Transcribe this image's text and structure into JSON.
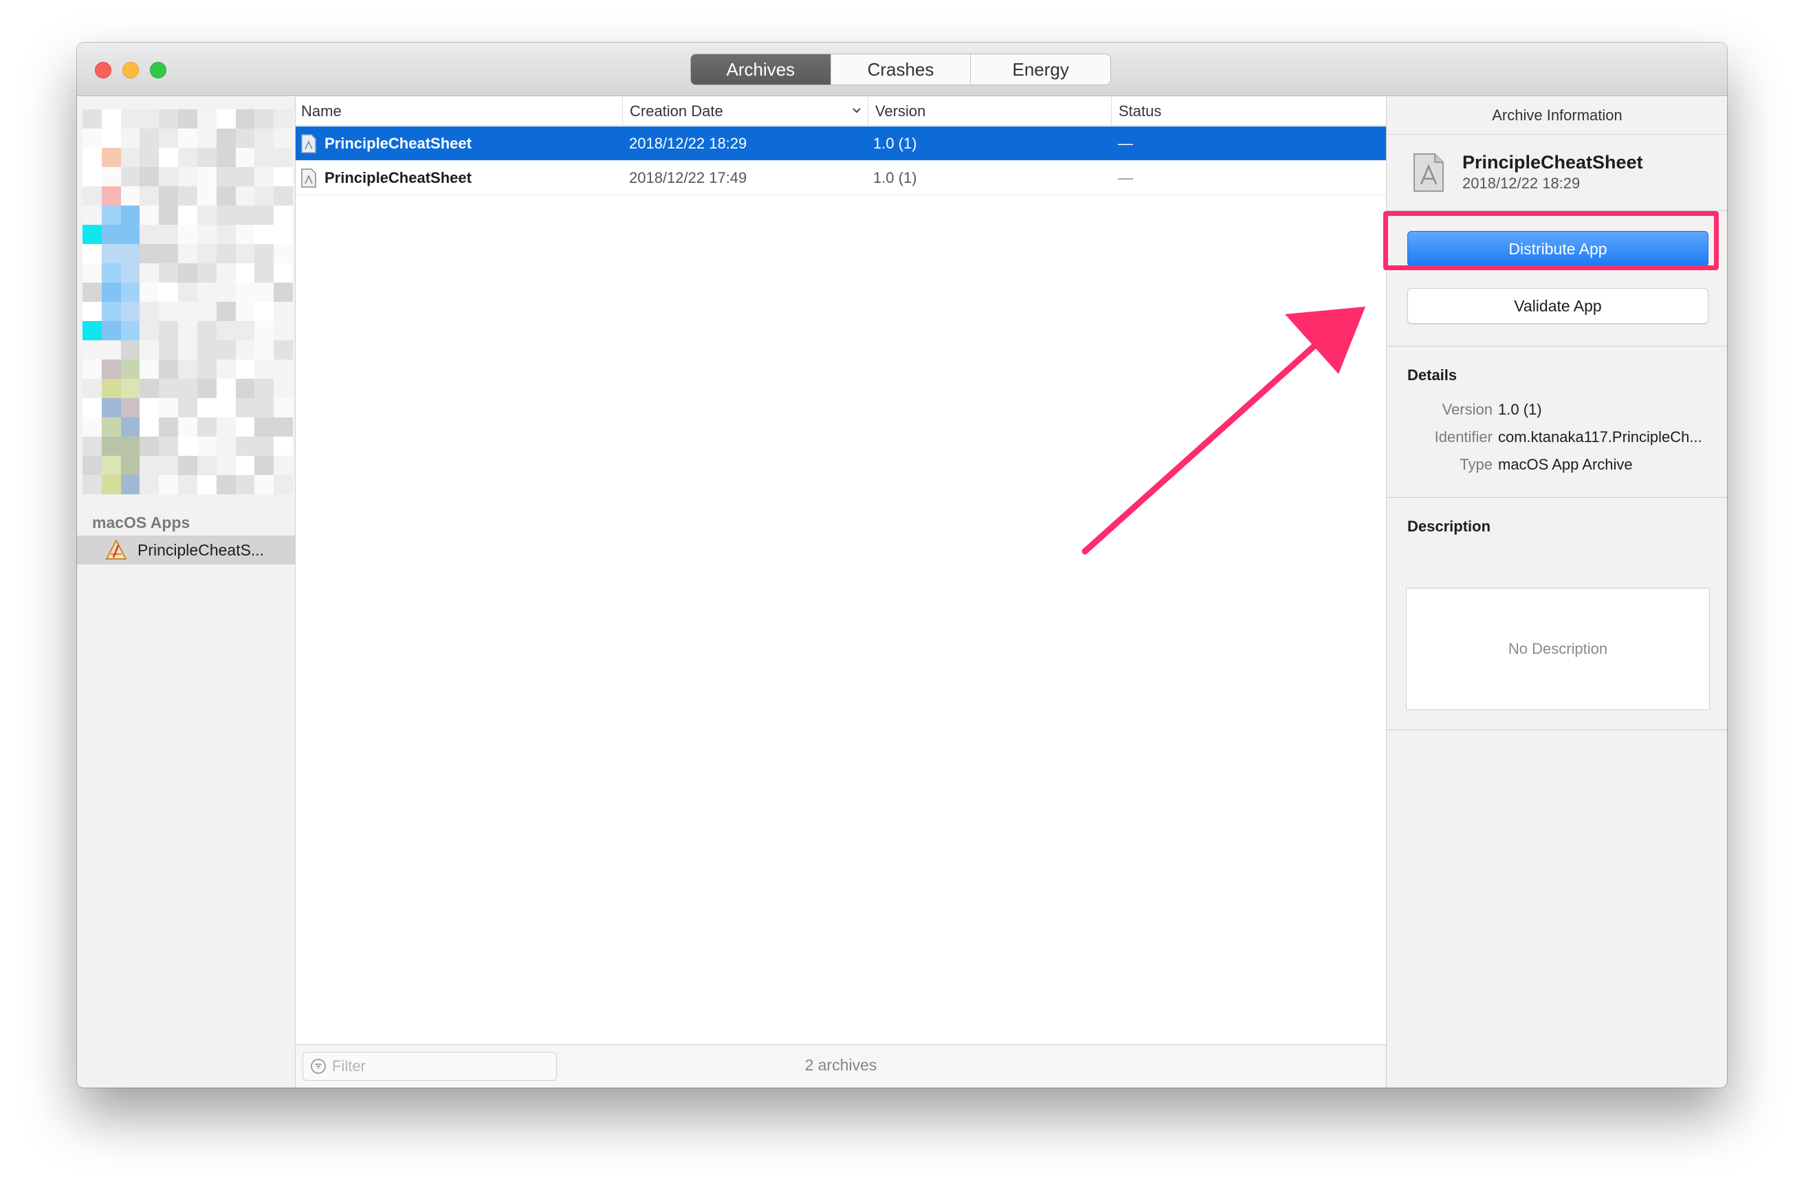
{
  "tabs": [
    {
      "label": "Archives",
      "active": true
    },
    {
      "label": "Crashes",
      "active": false
    },
    {
      "label": "Energy",
      "active": false
    }
  ],
  "sidebar": {
    "group_label": "macOS Apps",
    "item_label": "PrincipleCheatS..."
  },
  "table": {
    "columns": [
      "Name",
      "Creation Date",
      "Version",
      "Status"
    ],
    "rows": [
      {
        "name": "PrincipleCheatSheet",
        "date": "2018/12/22 18:29",
        "version": "1.0 (1)",
        "status": "—",
        "selected": true
      },
      {
        "name": "PrincipleCheatSheet",
        "date": "2018/12/22 17:49",
        "version": "1.0 (1)",
        "status": "—",
        "selected": false
      }
    ]
  },
  "footer": {
    "filter_placeholder": "Filter",
    "count": "2 archives"
  },
  "inspector": {
    "title": "Archive Information",
    "archive_name": "PrincipleCheatSheet",
    "archive_date": "2018/12/22 18:29",
    "primary_button": "Distribute App",
    "secondary_button": "Validate App",
    "details_title": "Details",
    "details": [
      {
        "key": "Version",
        "value": "1.0 (1)"
      },
      {
        "key": "Identifier",
        "value": "com.ktanaka117.PrincipleCh..."
      },
      {
        "key": "Type",
        "value": "macOS App Archive"
      }
    ],
    "description_title": "Description",
    "description_placeholder": "No Description"
  },
  "colors": {
    "selection": "#0d6bd8",
    "primary_button": "#1b7af3",
    "annotation": "#ff2c6c"
  }
}
